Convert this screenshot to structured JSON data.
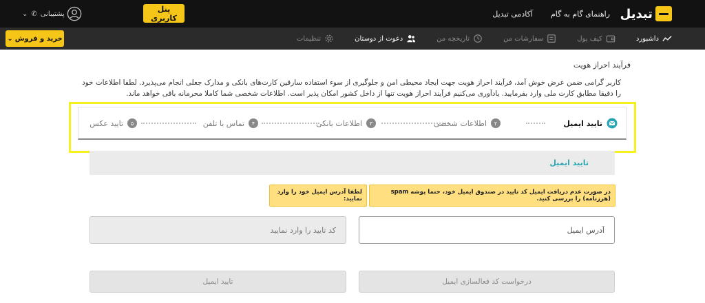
{
  "brand": {
    "name": "تبدیل"
  },
  "header": {
    "nav": [
      "راهنمای گام به گام",
      "آکادمی تبدیل"
    ],
    "panel_button": "پنل کاربری",
    "support": "پشتیبانی"
  },
  "subnav": {
    "items": [
      {
        "label": "داشبورد",
        "icon": "chart-icon",
        "active": true
      },
      {
        "label": "کیف پول",
        "icon": "wallet-icon",
        "active": false
      },
      {
        "label": "سفارشات من",
        "icon": "orders-icon",
        "active": false
      },
      {
        "label": "تاریخچه من",
        "icon": "history-icon",
        "active": false
      },
      {
        "label": "دعوت از دوستان",
        "icon": "users-icon",
        "active": true
      },
      {
        "label": "تنظیمات",
        "icon": "gear-icon",
        "active": false
      }
    ],
    "buy_sell_button": "خرید و فروش"
  },
  "page": {
    "title": "فرآیند احراز هویت",
    "intro": "کاربر گرامی ضمن عرض خوش آمد، فرآیند احراز هویت جهت ایجاد محیطی امن و جلوگیری از سوء استفاده سارقین کارت‌های بانکی و مدارک جعلی انجام می‌پذیرد. لطفا اطلاعات خود را دقیقا مطابق کارت ملی وارد بفرمایید. یادآوری می‌کنیم فرآیند احراز هویت تنها از داخل کشور امکان پذیر است. اطلاعات شخصی شما کاملا محرمانه باقی خواهد ماند."
  },
  "steps": [
    {
      "label": "تایید ایمیل",
      "num": "",
      "active": true
    },
    {
      "label": "اطلاعات شخصی",
      "num": "۲",
      "active": false
    },
    {
      "label": "اطلاعات بانکی",
      "num": "۳",
      "active": false
    },
    {
      "label": "تماس با تلفن",
      "num": "۴",
      "active": false
    },
    {
      "label": "تایید عکس",
      "num": "۵",
      "active": false
    }
  ],
  "email_section": {
    "title": "تایید ایمیل",
    "alert_spam": "در صورت عدم دریافت ایمیل کد تایید در صندوق ایمیل خود، حتما پوشه spam (هرزنامه) را بررسی کنید.",
    "alert_enter": "لطفا آدرس ایمیل خود را وارد نمایید:",
    "email_placeholder": "آدرس ایمیل",
    "code_placeholder": "کد تایید را وارد نمایید",
    "request_button": "درخواست کد فعالسازی ایمیل",
    "confirm_button": "تایید ایمیل"
  },
  "colors": {
    "accent": "#f5c518",
    "topbar": "#121212",
    "subbar": "#2b2b2b",
    "link": "#2aa7b5",
    "highlight": "#f5f01e"
  }
}
